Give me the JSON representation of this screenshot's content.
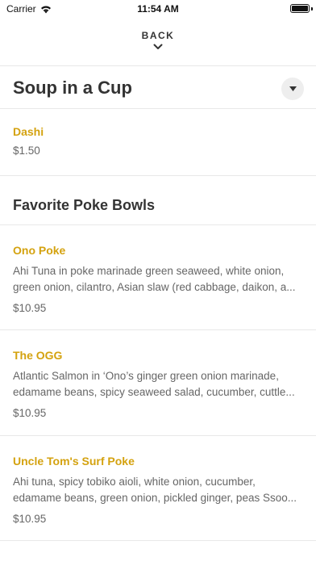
{
  "status_bar": {
    "carrier": "Carrier",
    "time": "11:54 AM"
  },
  "nav": {
    "back_label": "BACK"
  },
  "sections": [
    {
      "title": "Soup in a Cup",
      "items": [
        {
          "name": "Dashi",
          "price": "$1.50"
        }
      ]
    },
    {
      "title": "Favorite Poke Bowls",
      "items": [
        {
          "name": "Ono Poke",
          "description": "Ahi Tuna in poke marinade green seaweed, white onion, green onion, cilantro, Asian slaw (red cabbage, daikon, a...",
          "price": "$10.95"
        },
        {
          "name": "The OGG",
          "description": "Atlantic Salmon in ‘Ono’s ginger green onion marinade, edamame beans, spicy seaweed salad, cucumber, cuttle...",
          "price": "$10.95"
        },
        {
          "name": "Uncle Tom's Surf Poke",
          "description": "Ahi tuna, spicy tobiko aioli, white onion, cucumber, edamame beans, green onion, pickled ginger,  peas Ssoo...",
          "price": "$10.95"
        }
      ]
    }
  ],
  "colors": {
    "item_name": "#d4a20f",
    "divider": "#e8e8e8"
  }
}
